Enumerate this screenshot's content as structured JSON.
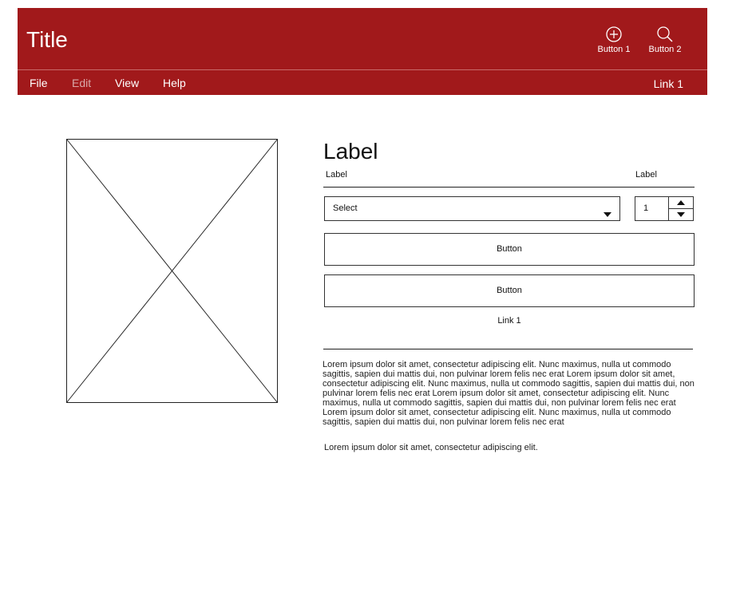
{
  "header": {
    "title": "Title",
    "buttons": [
      {
        "label": "Button 1",
        "icon": "plus-circle-icon"
      },
      {
        "label": "Button 2",
        "icon": "search-icon"
      }
    ]
  },
  "menu": {
    "items": [
      {
        "label": "File",
        "enabled": true
      },
      {
        "label": "Edit",
        "enabled": false
      },
      {
        "label": "View",
        "enabled": true
      },
      {
        "label": "Help",
        "enabled": true
      }
    ],
    "link": "Link 1"
  },
  "colors": {
    "brand": "#a1191b",
    "disabled_menu": "#d8a8a8"
  },
  "form": {
    "heading": "Label",
    "select_label": "Label",
    "stepper_label": "Label",
    "select_value": "Select",
    "stepper_value": "1",
    "button1": "Button",
    "button2": "Button",
    "link": "Link 1"
  },
  "content": {
    "paragraph": "Lorem ipsum dolor sit amet, consectetur adipiscing elit. Nunc maximus, nulla ut commodo sagittis, sapien dui mattis dui, non pulvinar lorem felis nec erat Lorem ipsum dolor sit amet, consectetur adipiscing elit. Nunc maximus, nulla ut commodo sagittis, sapien dui mattis dui, non pulvinar lorem felis nec erat Lorem ipsum dolor sit amet, consectetur adipiscing elit. Nunc maximus, nulla ut commodo sagittis, sapien dui mattis dui, non pulvinar lorem felis nec erat Lorem ipsum dolor sit amet, consectetur adipiscing elit. Nunc maximus, nulla ut commodo sagittis, sapien dui mattis dui, non pulvinar lorem felis nec erat",
    "short": "Lorem ipsum dolor sit amet, consectetur adipiscing elit."
  }
}
